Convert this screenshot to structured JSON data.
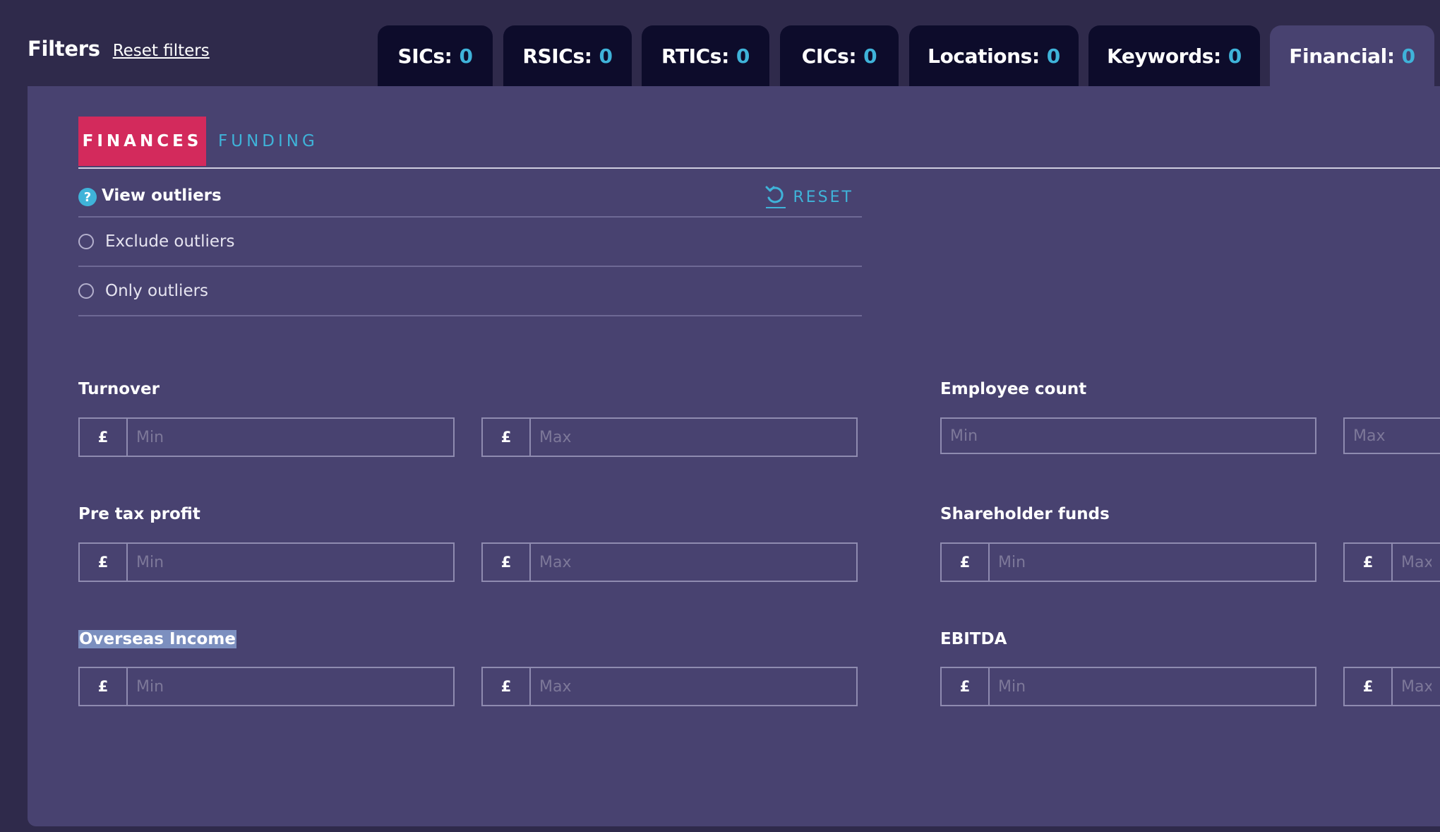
{
  "header": {
    "title": "Filters",
    "reset_label": "Reset filters"
  },
  "tabs": [
    {
      "label": "SICs:",
      "count": "0"
    },
    {
      "label": "RSICs:",
      "count": "0"
    },
    {
      "label": "RTICs:",
      "count": "0"
    },
    {
      "label": "CICs:",
      "count": "0"
    },
    {
      "label": "Locations:",
      "count": "0"
    },
    {
      "label": "Keywords:",
      "count": "0"
    },
    {
      "label": "Financial:",
      "count": "0"
    }
  ],
  "active_tab": "Financial:",
  "subtabs": {
    "finances": "FINANCES",
    "funding": "FUNDING",
    "active": "FINANCES"
  },
  "outliers": {
    "help_glyph": "?",
    "title": "View outliers",
    "reset_label": "RESET",
    "options": [
      {
        "label": "Exclude outliers",
        "selected": false
      },
      {
        "label": "Only outliers",
        "selected": false
      }
    ]
  },
  "fields": {
    "currency_symbol": "£",
    "min_placeholder": "Min",
    "max_placeholder": "Max",
    "turnover": "Turnover",
    "employee_count": "Employee count",
    "pre_tax_profit": "Pre tax profit",
    "shareholder_funds": "Shareholder funds",
    "overseas_income": "Overseas Income",
    "ebitda": "EBITDA"
  },
  "colors": {
    "accent": "#3fb3d9",
    "active_subtab": "#d32a5c",
    "panel": "#484270",
    "tab_dark": "#0d0c2b",
    "page_bg": "#2f2a4b"
  },
  "icons": {
    "help": "help-circle-icon",
    "reset": "rotate-ccw-icon"
  }
}
